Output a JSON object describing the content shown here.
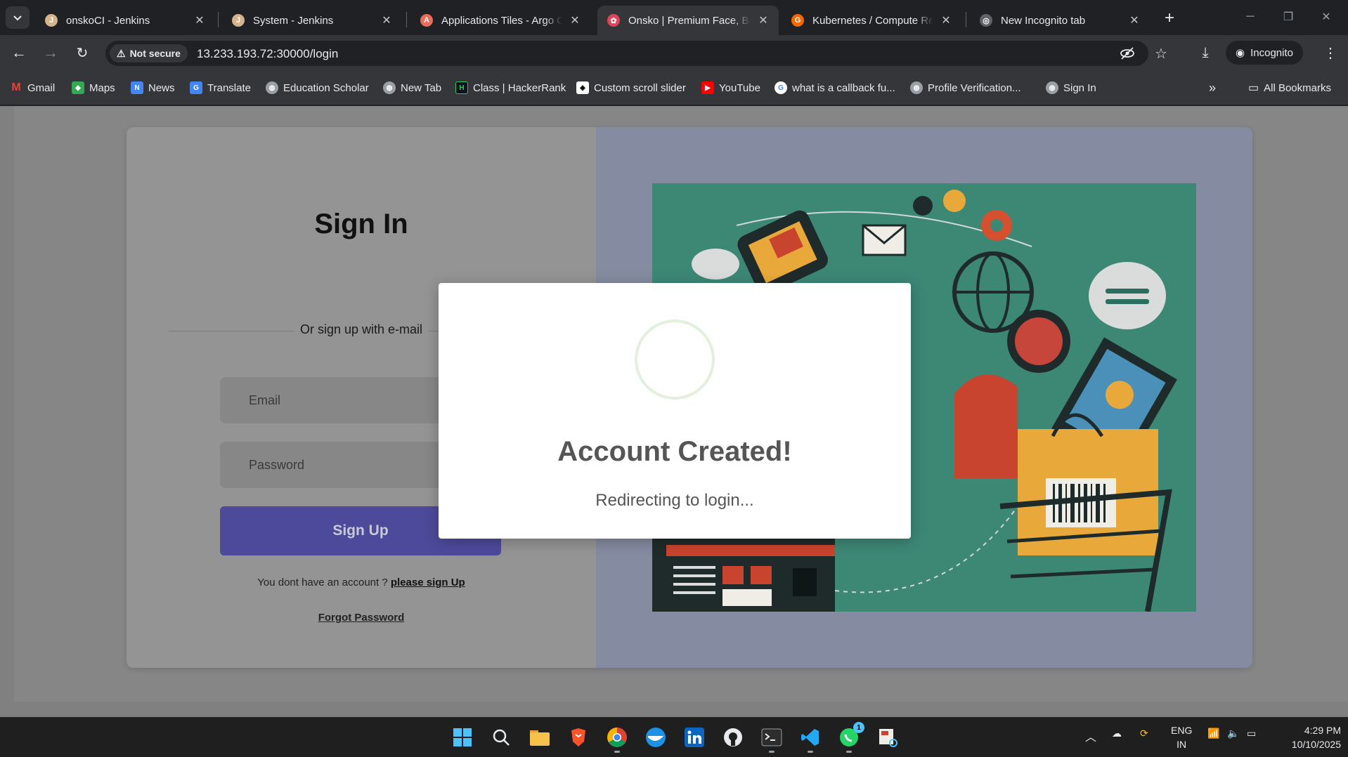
{
  "tabs": [
    {
      "title": "onskoCI - Jenkins",
      "favicon": "jenkins-icon"
    },
    {
      "title": "System - Jenkins",
      "favicon": "jenkins-icon"
    },
    {
      "title": "Applications Tiles - Argo CD",
      "favicon": "argo-icon"
    },
    {
      "title": "Onsko | Premium Face, Body",
      "favicon": "onsko-icon",
      "active": true
    },
    {
      "title": "Kubernetes / Compute Resources",
      "favicon": "grafana-icon"
    },
    {
      "title": "New Incognito tab",
      "favicon": "incognito-icon"
    }
  ],
  "toolbar": {
    "security_label": "Not secure",
    "url": "13.233.193.72:30000/login",
    "profile_label": "Incognito"
  },
  "bookmarks": [
    {
      "label": "Gmail",
      "icon": "gmail-icon"
    },
    {
      "label": "Maps",
      "icon": "maps-icon"
    },
    {
      "label": "News",
      "icon": "news-icon"
    },
    {
      "label": "Translate",
      "icon": "translate-icon"
    },
    {
      "label": "Education Scholar",
      "icon": "globe-icon"
    },
    {
      "label": "New Tab",
      "icon": "globe-icon"
    },
    {
      "label": "Class | HackerRank",
      "icon": "hackerrank-icon"
    },
    {
      "label": "Custom scroll slider",
      "icon": "codepen-icon"
    },
    {
      "label": "YouTube",
      "icon": "youtube-icon"
    },
    {
      "label": "what is a callback fu...",
      "icon": "google-icon"
    },
    {
      "label": "Profile Verification...",
      "icon": "globe-icon"
    },
    {
      "label": "Sign In",
      "icon": "globe-icon"
    }
  ],
  "all_bookmarks_label": "All Bookmarks",
  "signin": {
    "title": "Sign In",
    "divider_text": "Or sign up with e-mail",
    "email_placeholder": "Email",
    "password_placeholder": "Password",
    "submit_label": "Sign Up",
    "account_prompt": "You dont have an account ?",
    "signup_link": "please sign Up",
    "forgot_link": "Forgot Password"
  },
  "modal": {
    "title": "Account Created!",
    "message": "Redirecting to login..."
  },
  "taskbar": {
    "language": "ENG",
    "region": "IN",
    "time": "4:29 PM",
    "date": "10/10/2025",
    "whatsapp_badge": "1"
  },
  "colors": {
    "tab_bg": "#202124",
    "toolbar_bg": "#35363a",
    "button_purple": "#4d4a9b",
    "illustration_teal": "#3a8b7a"
  }
}
